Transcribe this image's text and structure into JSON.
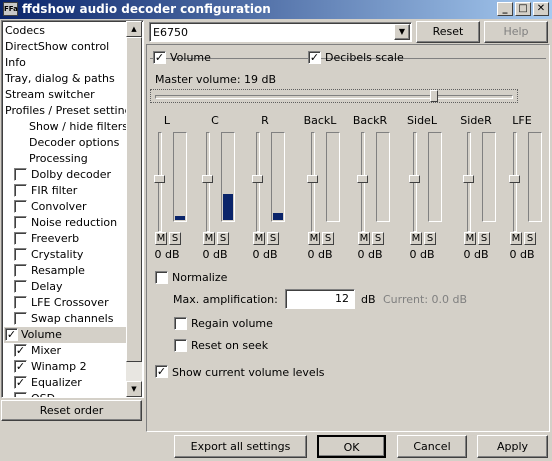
{
  "window": {
    "title": "ffdshow audio decoder configuration",
    "icon_text": "FFa",
    "minimize_glyph": "_",
    "maximize_glyph": "□",
    "close_glyph": "✕"
  },
  "tree": {
    "items": [
      {
        "label": "Codecs"
      },
      {
        "label": "DirectShow control"
      },
      {
        "label": "Info"
      },
      {
        "label": "Tray, dialog & paths"
      },
      {
        "label": "Stream switcher"
      },
      {
        "label": "Profiles / Preset settings"
      },
      {
        "label": "Show / hide filters"
      },
      {
        "label": "Decoder options"
      },
      {
        "label": "Processing"
      },
      {
        "label": "Dolby decoder",
        "checked": false
      },
      {
        "label": "FIR filter",
        "checked": false
      },
      {
        "label": "Convolver",
        "checked": false
      },
      {
        "label": "Noise reduction",
        "checked": false
      },
      {
        "label": "Freeverb",
        "checked": false
      },
      {
        "label": "Crystality",
        "checked": false
      },
      {
        "label": "Resample",
        "checked": false
      },
      {
        "label": "Delay",
        "checked": false
      },
      {
        "label": "LFE Crossover",
        "checked": false
      },
      {
        "label": "Swap channels",
        "checked": false
      },
      {
        "label": "Volume",
        "checked": true,
        "selected": true
      },
      {
        "label": "Mixer",
        "checked": true
      },
      {
        "label": "Winamp 2",
        "checked": true
      },
      {
        "label": "Equalizer",
        "checked": true
      },
      {
        "label": "OSD",
        "checked": false
      }
    ],
    "check_glyph": "✓"
  },
  "scroll": {
    "up": "▲",
    "down": "▼"
  },
  "reset_order_label": "Reset order",
  "preset": {
    "value": "E6750",
    "arrow": "▼",
    "reset_label": "Reset",
    "help_label": "Help"
  },
  "volume": {
    "enabled_label": "Volume",
    "enabled": true,
    "decibels_label": "Decibels scale",
    "decibels": true,
    "master_label": "Master volume: 19 dB",
    "master_level": 0.78,
    "channels": [
      {
        "name": "L",
        "level": 0.04,
        "db": "0 dB"
      },
      {
        "name": "C",
        "level": 0.29,
        "db": "0 dB"
      },
      {
        "name": "R",
        "level": 0.08,
        "db": "0 dB"
      },
      {
        "name": "BackL",
        "level": 0,
        "db": "0 dB"
      },
      {
        "name": "BackR",
        "level": 0,
        "db": "0 dB"
      },
      {
        "name": "SideL",
        "level": 0,
        "db": "0 dB"
      },
      {
        "name": "SideR",
        "level": 0,
        "db": "0 dB"
      },
      {
        "name": "LFE",
        "level": 0,
        "db": "0 dB"
      }
    ],
    "m_label": "M",
    "s_label": "S",
    "normalize_label": "Normalize",
    "max_amp_label": "Max. amplification:",
    "max_amp_value": "12",
    "db_unit": "dB",
    "current_label": "Current:  0.0 dB",
    "regain_label": "Regain volume",
    "reset_seek_label": "Reset on seek",
    "show_levels_label": "Show current volume levels"
  },
  "footer": {
    "export_label": "Export all settings",
    "ok_label": "OK",
    "cancel_label": "Cancel",
    "apply_label": "Apply"
  },
  "colors": {
    "meter_fill": "#0a246a",
    "title_start": "#0a246a",
    "title_end": "#a6caf0"
  }
}
